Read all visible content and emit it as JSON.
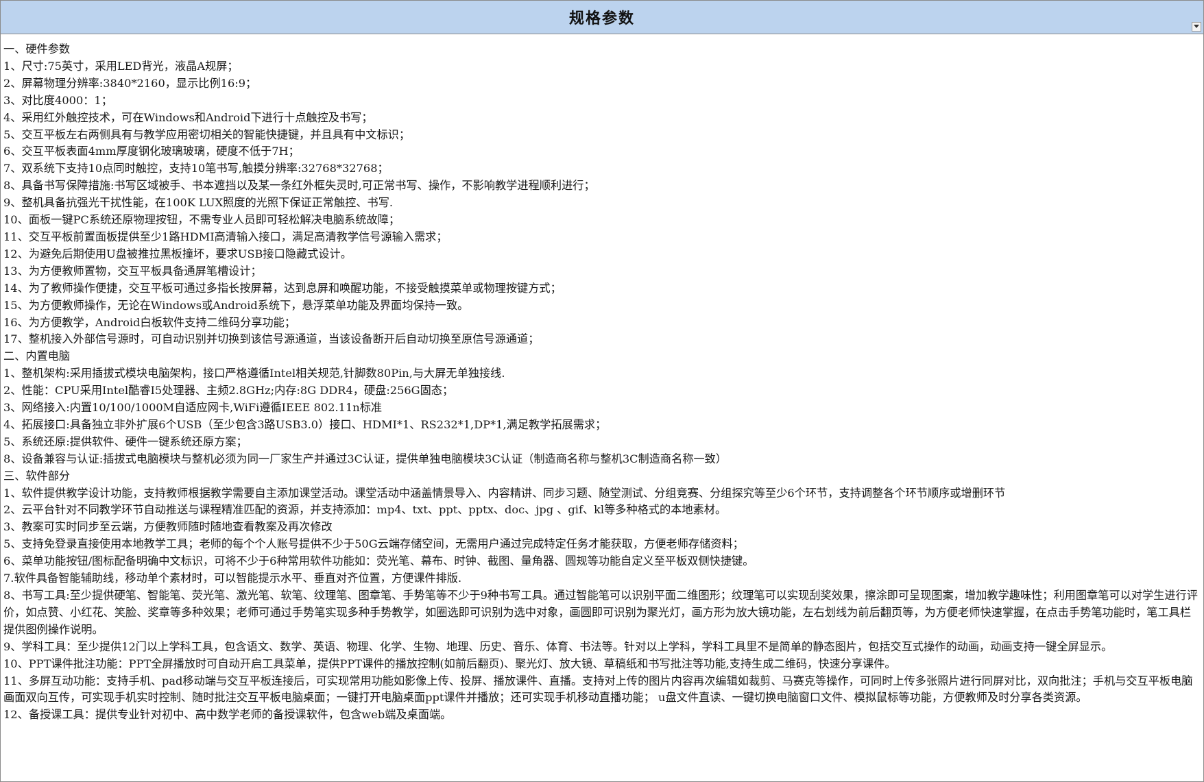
{
  "sheet": {
    "title": "规格参数",
    "filter_icon": "dropdown-arrow-icon",
    "lines": [
      "一、硬件参数",
      "1、尺寸:75英寸，采用LED背光，液晶A规屏；",
      "2、屏幕物理分辨率:3840*2160，显示比例16:9；",
      "3、对比度4000：1；",
      "4、采用红外触控技术，可在Windows和Android下进行十点触控及书写；",
      "5、交互平板左右两侧具有与教学应用密切相关的智能快捷键，并且具有中文标识；",
      "6、交互平板表面4mm厚度钢化玻璃玻璃，硬度不低于7H；",
      "7、双系统下支持10点同时触控，支持10笔书写,触摸分辨率:32768*32768；",
      "8、具备书写保障措施:书写区域被手、书本遮挡以及某一条红外框失灵时,可正常书写、操作，不影响教学进程顺利进行；",
      "9、整机具备抗强光干扰性能，在100K LUX照度的光照下保证正常触控、书写.",
      "10、面板一键PC系统还原物理按钮，不需专业人员即可轻松解决电脑系统故障；",
      "11、交互平板前置面板提供至少1路HDMI高清输入接口，满足高清教学信号源输入需求；",
      "12、为避免后期使用U盘被推拉黑板撞坏，要求USB接口隐藏式设计。",
      "13、为方便教师置物，交互平板具备通屏笔槽设计；",
      "14、为了教师操作便捷，交互平板可通过多指长按屏幕，达到息屏和唤醒功能，不接受触摸菜单或物理按键方式；",
      "15、为方便教师操作，无论在Windows或Android系统下，悬浮菜单功能及界面均保持一致。",
      "16、为方便教学，Android白板软件支持二维码分享功能；",
      "17、整机接入外部信号源时，可自动识别并切换到该信号源通道，当该设备断开后自动切换至原信号源通道；",
      "二、内置电脑",
      "1、整机架构:采用插拔式模块电脑架构，接口严格遵循Intel相关规范,针脚数80Pin,与大屏无单独接线.",
      "2、性能：CPU采用Intel酷睿I5处理器、主频2.8GHz;内存:8G DDR4，硬盘:256G固态；",
      "3、网络接入:内置10/100/1000M自适应网卡,WiFi遵循IEEE 802.11n标准",
      "4、拓展接口:具备独立非外扩展6个USB（至少包含3路USB3.0）接口、HDMI*1、RS232*1,DP*1,满足教学拓展需求；",
      "5、系统还原:提供软件、硬件一键系统还原方案；",
      "8、设备兼容与认证:插拔式电脑模块与整机必须为同一厂家生产并通过3C认证，提供单独电脑模块3C认证（制造商名称与整机3C制造商名称一致）",
      "三、软件部分",
      "1、软件提供教学设计功能，支持教师根据教学需要自主添加课堂活动。课堂活动中涵盖情景导入、内容精讲、同步习题、随堂测试、分组竞赛、分组探究等至少6个环节，支持调整各个环节顺序或增删环节",
      "2、云平台针对不同教学环节自动推送与课程精准匹配的资源，并支持添加：mp4、txt、ppt、pptx、doc、jpg 、gif、kl等多种格式的本地素材。",
      "3、教案可实时同步至云端，方便教师随时随地查看教案及再次修改",
      "5、支持免登录直接使用本地教学工具；老师的每个个人账号提供不少于50G云端存储空间，无需用户通过完成特定任务才能获取，方便老师存储资料；",
      "6、菜单功能按钮/图标配备明确中文标识，可将不少于6种常用软件功能如：荧光笔、幕布、时钟、截图、量角器、圆规等功能自定义至平板双侧快捷键。",
      "7.软件具备智能辅助线，移动单个素材时，可以智能提示水平、垂直对齐位置，方便课件排版.",
      "8、书写工具:至少提供硬笔、智能笔、荧光笔、激光笔、软笔、纹理笔、图章笔、手势笔等不少于9种书写工具。通过智能笔可以识别平面二维图形；纹理笔可以实现刮奖效果，擦涂即可呈现图案，增加教学趣味性；利用图章笔可以对学生进行评价，如点赞、小红花、笑脸、奖章等多种效果；老师可通过手势笔实现多种手势教学，如圈选即可识别为选中对象，画圆即可识别为聚光灯，画方形为放大镜功能，左右划线为前后翻页等，为方便老师快速掌握，在点击手势笔功能时，笔工具栏提供图例操作说明。",
      "9、学科工具：至少提供12门以上学科工具，包含语文、数学、英语、物理、化学、生物、地理、历史、音乐、体育、书法等。针对以上学科，学科工具里不是简单的静态图片，包括交互式操作的动画，动画支持一键全屏显示。",
      "10、PPT课件批注功能：PPT全屏播放时可自动开启工具菜单，提供PPT课件的播放控制(如前后翻页)、聚光灯、放大镜、草稿纸和书写批注等功能,支持生成二维码，快速分享课件。",
      "11、多屏互动功能：支持手机、pad移动端与交互平板连接后，可实现常用功能如影像上传、投屏、播放课件、直播。支持对上传的图片内容再次编辑如裁剪、马赛克等操作，可同时上传多张照片进行同屏对比，双向批注；手机与交互平板电脑画面双向互传，可实现手机实时控制、随时批注交互平板电脑桌面；一键打开电脑桌面ppt课件并播放；还可实现手机移动直播功能； u盘文件直读、一键切换电脑窗口文件、模拟鼠标等功能，方便教师及时分享各类资源。",
      "12、备授课工具：提供专业针对初中、高中数学老师的备授课软件，包含web端及桌面端。"
    ]
  }
}
